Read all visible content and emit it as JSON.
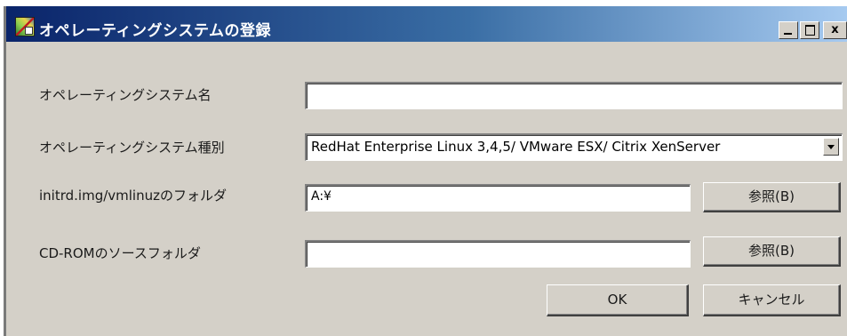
{
  "window": {
    "title": "オペレーティングシステムの登録",
    "minimize_label": "_",
    "maximize_label": "",
    "close_label": "x"
  },
  "form": {
    "os_name": {
      "label": "オペレーティングシステム名",
      "value": ""
    },
    "os_type": {
      "label": "オペレーティングシステム種別",
      "selected": "RedHat Enterprise Linux 3,4,5/ VMware ESX/ Citrix XenServer"
    },
    "initrd_folder": {
      "label": "initrd.img/vmlinuzのフォルダ",
      "value": "A:¥",
      "browse_label": "参照(B)"
    },
    "cdrom_folder": {
      "label": "CD-ROMのソースフォルダ",
      "value": "",
      "browse_label": "参照(B)"
    }
  },
  "buttons": {
    "ok_label": "OK",
    "cancel_label": "キャンセル"
  },
  "icons": {
    "app": "app-icon",
    "minimize": "minimize-icon",
    "maximize": "maximize-icon",
    "close": "close-icon",
    "dropdown": "chevron-down-icon"
  },
  "colors": {
    "titlebar_start": "#0a246a",
    "titlebar_end": "#a6caf0",
    "window_bg": "#d4d0c8"
  }
}
